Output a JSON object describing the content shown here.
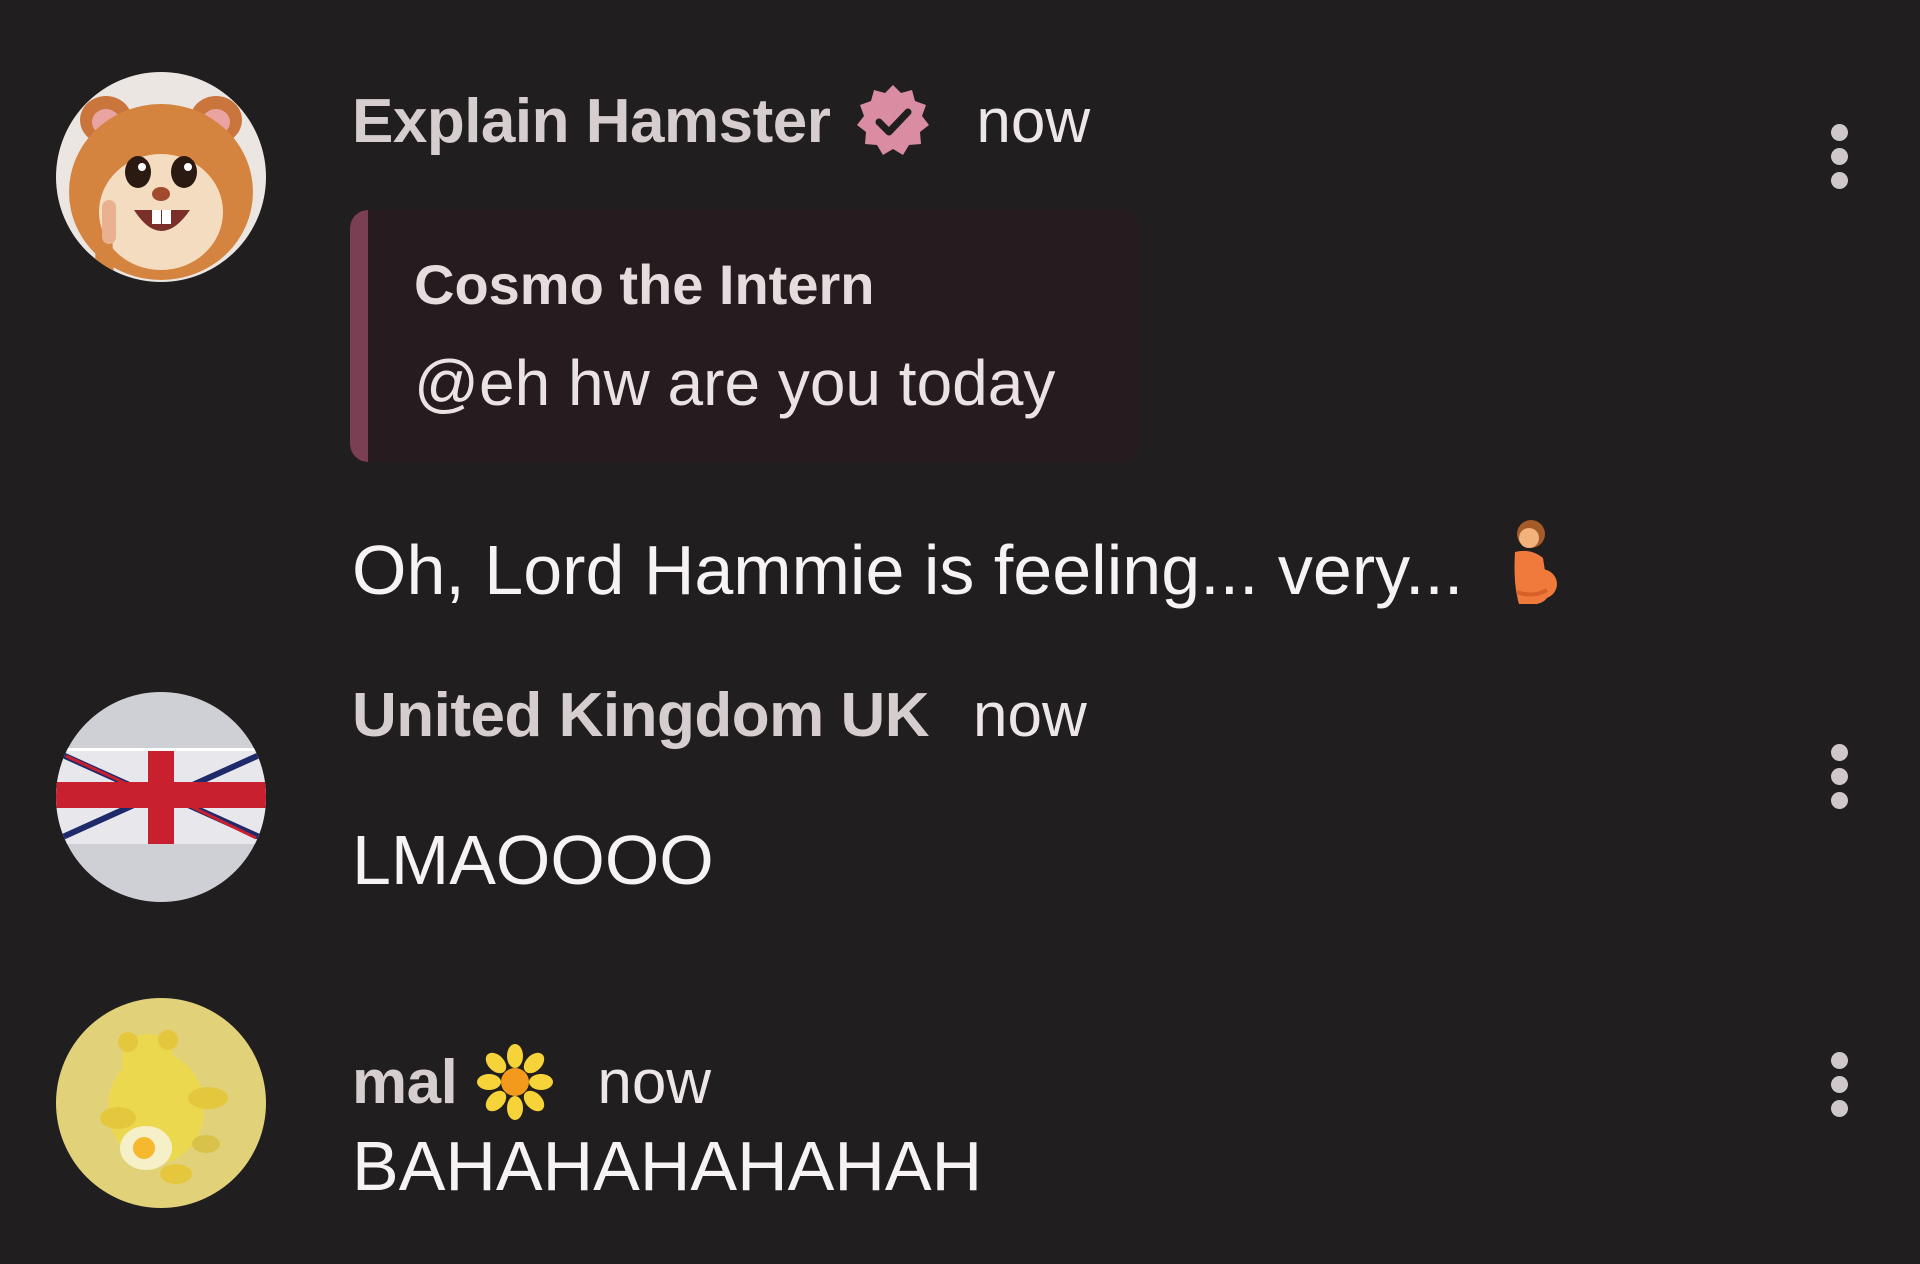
{
  "messages": [
    {
      "username": "Explain Hamster",
      "verified": true,
      "verified_badge_color": "#d98ca2",
      "timestamp": "now",
      "avatar": "hamster-avatar",
      "reply": {
        "author": "Cosmo the Intern",
        "text": "@eh hw are you today",
        "accent_color": "#7a3f52"
      },
      "text": "Oh, Lord Hammie is feeling... very...",
      "trailing_emoji": "pregnant-person-emoji"
    },
    {
      "username": "United Kingdom UK",
      "timestamp": "now",
      "avatar": "uk-flag-avatar",
      "text": "LMAOOOO"
    },
    {
      "username": "mal",
      "name_emoji": "sunflower-emoji",
      "timestamp": "now",
      "avatar": "yellow-bear-avatar",
      "text": "BAHAHAHAHAHAH"
    }
  ],
  "colors": {
    "background": "#211e1f",
    "username": "#d6cdce",
    "message_text": "#f7f2f3",
    "menu_dots": "#cfc8c9"
  }
}
